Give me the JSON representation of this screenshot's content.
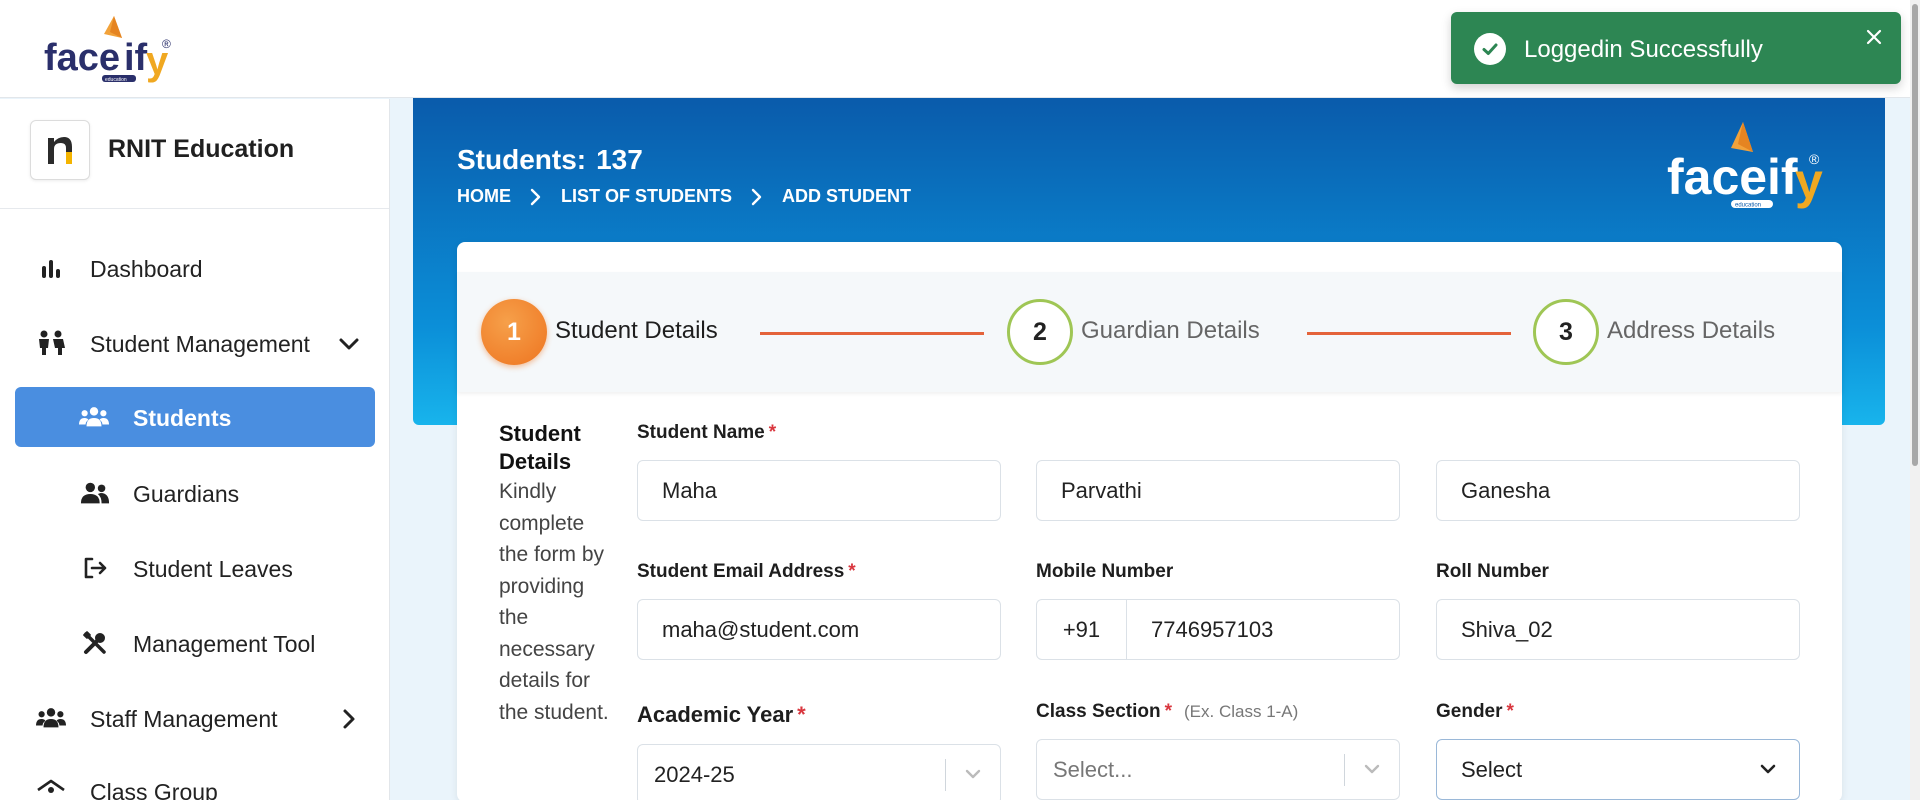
{
  "brand": {
    "logo_text_face": "face",
    "logo_text_if": "if",
    "logo_text_y": "y",
    "logo_sub": "education",
    "logo_reg": "®"
  },
  "toast": {
    "message": "Loggedin Successfully"
  },
  "org": {
    "initial": "n",
    "name": "RNIT Education"
  },
  "nav": {
    "dashboard": "Dashboard",
    "student_management": "Student Management",
    "students": "Students",
    "guardians": "Guardians",
    "student_leaves": "Student Leaves",
    "management_tool": "Management Tool",
    "staff_management": "Staff Management",
    "class_group": "Class Group"
  },
  "header": {
    "title": "Students:",
    "count": "137",
    "breadcrumb": [
      "HOME",
      "LIST OF STUDENTS",
      "ADD STUDENT"
    ]
  },
  "stepper": {
    "steps": [
      {
        "number": "1",
        "label": "Student Details"
      },
      {
        "number": "2",
        "label": "Guardian Details"
      },
      {
        "number": "3",
        "label": "Address Details"
      }
    ]
  },
  "form": {
    "section_title": "Student Details",
    "section_desc": "Kindly complete the form by providing the necessary details for the student.",
    "student_name_label": "Student Name",
    "first_name": "Maha",
    "middle_name": "Parvathi",
    "last_name": "Ganesha",
    "email_label": "Student Email Address",
    "email": "maha@student.com",
    "mobile_label": "Mobile Number",
    "mobile_prefix": "+91",
    "mobile": "7746957103",
    "roll_label": "Roll Number",
    "roll": "Shiva_02",
    "academic_year_label": "Academic Year",
    "academic_year": "2024-25",
    "class_section_label": "Class Section",
    "class_section_hint": "(Ex. Class 1-A)",
    "class_section_placeholder": "Select...",
    "gender_label": "Gender",
    "gender_value": "Select",
    "required_mark": "*"
  },
  "colors": {
    "accent": "#4a8ee0",
    "toast": "#2d8653",
    "step_active": "#ee7420",
    "step_line": "#e4633a"
  }
}
